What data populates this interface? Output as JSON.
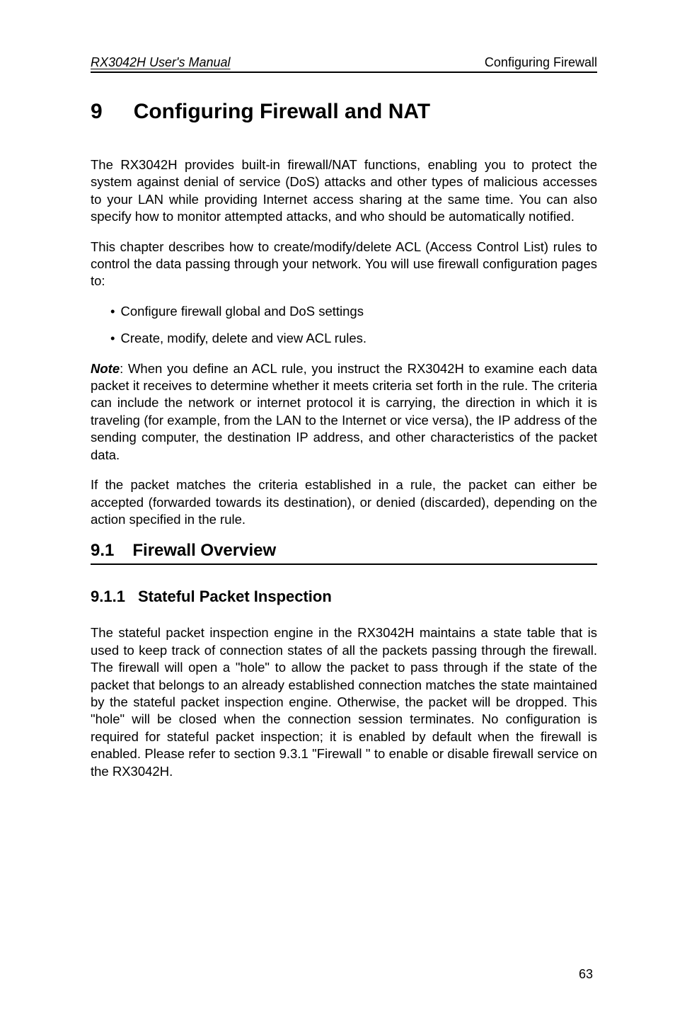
{
  "header": {
    "left": "RX3042H User's Manual",
    "right": "Configuring Firewall"
  },
  "chapter": {
    "number": "9",
    "title": "Configuring Firewall and NAT"
  },
  "paragraphs": {
    "p1": "The RX3042H provides built-in firewall/NAT functions, enabling you to protect the system against denial of service (DoS) attacks and other types of malicious accesses to your LAN while providing Internet access sharing at the same time. You can also specify how to monitor attempted attacks, and who should be automatically notified.",
    "p2": "This chapter describes how to create/modify/delete ACL (Access Control List) rules to control the data passing through your network. You will use firewall configuration pages to:",
    "bullets": [
      "Configure firewall global and DoS settings",
      "Create, modify, delete and view ACL rules."
    ],
    "note_label": "Note",
    "note_text": ": When you define an ACL rule, you instruct the RX3042H to examine each data packet it receives to determine whether it meets criteria set forth in the rule. The criteria can include the network or internet protocol it is carrying, the direction in which it is traveling (for example, from the LAN to the Internet or vice versa), the IP address of the sending computer, the destination IP address, and other characteristics of the packet data.",
    "p4": "If the packet matches the criteria established in a rule, the packet can either be accepted (forwarded towards its destination), or denied (discarded), depending on the action specified in the rule."
  },
  "section": {
    "number": "9.1",
    "title": "Firewall Overview"
  },
  "subsection": {
    "number": "9.1.1",
    "title": "Stateful Packet Inspection",
    "body": "The stateful packet inspection engine in the RX3042H maintains a state table that is used to keep track of connection states of all the packets passing through the firewall. The firewall will open a \"hole\" to allow the packet to pass through if the state of the packet that belongs to an already established connection matches the state maintained by the stateful packet inspection engine. Otherwise, the packet will be dropped. This \"hole\" will be closed when the connection session terminates. No configuration is required for stateful packet inspection; it is enabled by default when the firewall is enabled. Please refer to section 9.3.1 \"Firewall \" to enable or disable firewall service on the RX3042H."
  },
  "page_number": "63"
}
